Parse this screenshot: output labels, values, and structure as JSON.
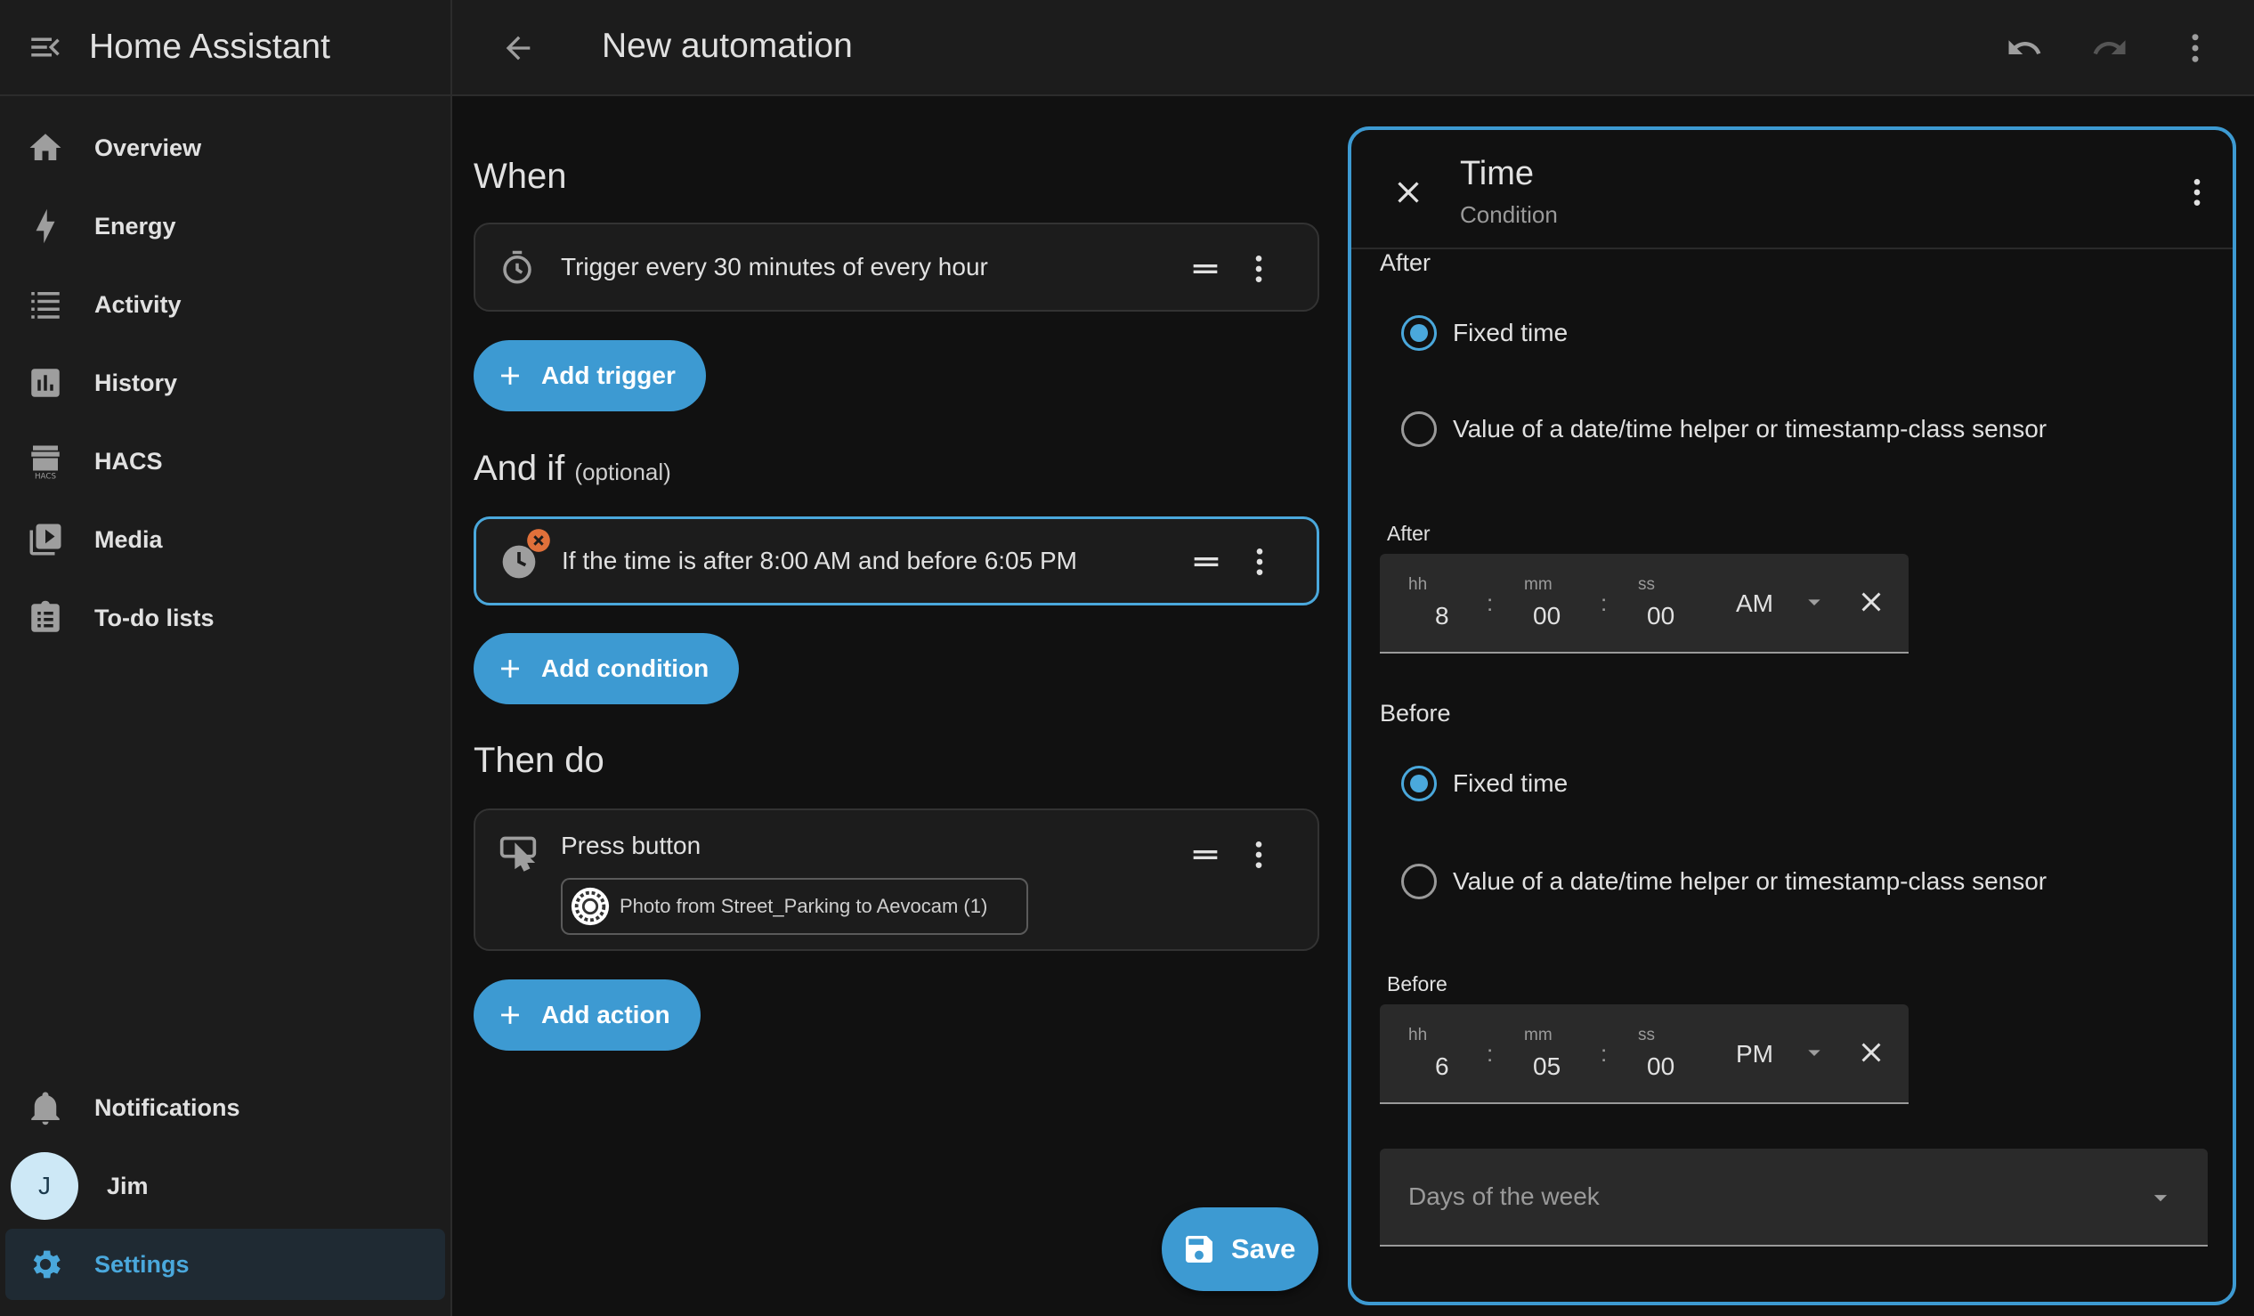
{
  "app": {
    "title": "Home Assistant"
  },
  "sidebar": {
    "items": [
      {
        "label": "Overview",
        "icon": "home-icon"
      },
      {
        "label": "Energy",
        "icon": "lightning-bolt-icon"
      },
      {
        "label": "Activity",
        "icon": "format-list-icon"
      },
      {
        "label": "History",
        "icon": "chart-box-icon"
      },
      {
        "label": "HACS",
        "icon": "hacs-icon"
      },
      {
        "label": "Media",
        "icon": "play-box-multiple-icon"
      },
      {
        "label": "To-do lists",
        "icon": "clipboard-list-icon"
      }
    ],
    "notifications": {
      "label": "Notifications",
      "icon": "bell-icon"
    },
    "user": {
      "initial": "J",
      "name": "Jim"
    },
    "settings": {
      "label": "Settings",
      "icon": "cog-icon"
    }
  },
  "topbar": {
    "title": "New automation"
  },
  "editor": {
    "when": {
      "title": "When",
      "trigger": "Trigger every 30 minutes of every hour",
      "add_label": "Add trigger"
    },
    "and_if": {
      "title": "And if",
      "optional": "(optional)",
      "condition": "If the time is after 8:00 AM and before 6:05 PM",
      "add_label": "Add condition"
    },
    "then_do": {
      "title": "Then do",
      "action": "Press button",
      "target_chip": "Photo from Street_Parking to Aevocam (1)",
      "add_label": "Add action"
    },
    "save_label": "Save"
  },
  "panel": {
    "title": "Time",
    "subtitle": "Condition",
    "after": {
      "heading": "After",
      "option_fixed": "Fixed time",
      "option_helper": "Value of a date/time helper or timestamp-class sensor",
      "field_label": "After",
      "hh_label": "hh",
      "mm_label": "mm",
      "ss_label": "ss",
      "hh": "8",
      "mm": "00",
      "ss": "00",
      "ampm": "AM",
      "sep": ":"
    },
    "before": {
      "heading": "Before",
      "option_fixed": "Fixed time",
      "option_helper": "Value of a date/time helper or timestamp-class sensor",
      "field_label": "Before",
      "hh_label": "hh",
      "mm_label": "mm",
      "ss_label": "ss",
      "hh": "6",
      "mm": "05",
      "ss": "00",
      "ampm": "PM",
      "sep": ":"
    },
    "days_placeholder": "Days of the week"
  },
  "colors": {
    "accent": "#3d9ad2",
    "background": "#111111",
    "surface": "#1c1c1c",
    "error_badge": "#e0703a"
  }
}
